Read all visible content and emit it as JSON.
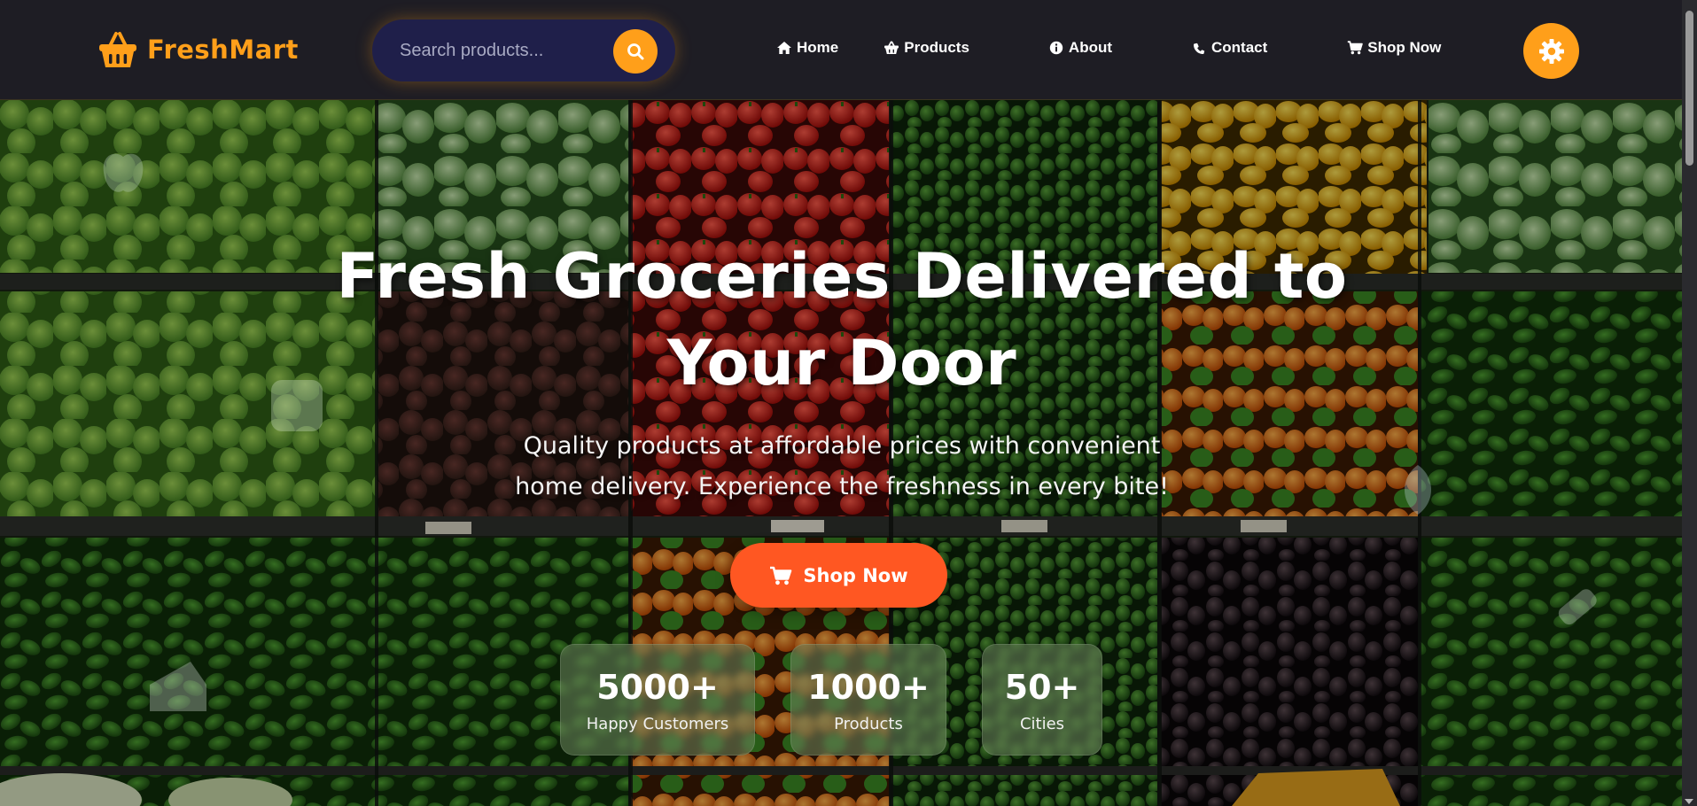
{
  "brand": {
    "name": "FreshMart",
    "icon": "shopping-basket-icon"
  },
  "search": {
    "placeholder": "Search products...",
    "icon": "search-icon"
  },
  "nav": {
    "items": [
      {
        "label": "Home",
        "icon": "home-icon"
      },
      {
        "label": "Products",
        "icon": "basket-icon"
      },
      {
        "label": "About",
        "icon": "info-circle-icon"
      },
      {
        "label": "Contact",
        "icon": "phone-icon"
      },
      {
        "label": "Shop Now",
        "icon": "cart-icon"
      }
    ],
    "settings_icon": "gear-icon"
  },
  "hero": {
    "title_line1": "Fresh Groceries Delivered to",
    "title_line2": "Your Door",
    "subtitle_line1": "Quality products at affordable prices with convenient",
    "subtitle_line2": "home delivery. Experience the freshness in every bite!",
    "cta_label": "Shop Now",
    "cta_icon": "cart-icon"
  },
  "stats": [
    {
      "value": "5000+",
      "label": "Happy Customers"
    },
    {
      "value": "1000+",
      "label": "Products"
    },
    {
      "value": "50+",
      "label": "Cities"
    }
  ],
  "colors": {
    "accent": "#ff9f1a",
    "cta": "#ff5722",
    "navbar_bg": "#1e1d24",
    "search_bg": "#1f1f4a"
  }
}
